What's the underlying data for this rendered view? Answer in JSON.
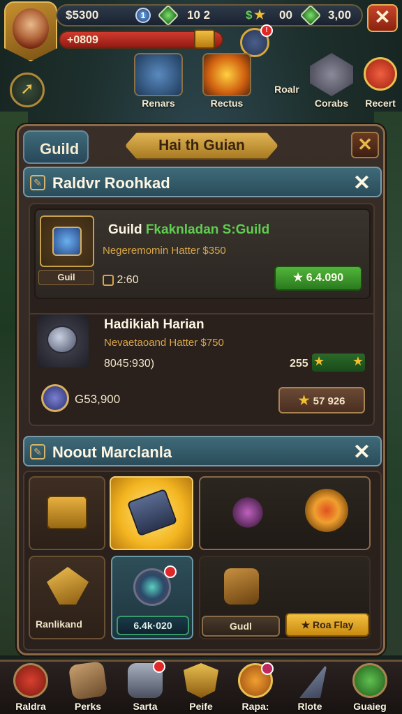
{
  "hud": {
    "gold": "$5300",
    "level_badge": "1",
    "gems": "10 2",
    "stars": "00",
    "currency": "3,00",
    "hp_value": "+0809",
    "compass_badge": "!"
  },
  "top_menu": [
    {
      "label": "Renars"
    },
    {
      "label": "Rectus"
    },
    {
      "label": "Roalr"
    },
    {
      "label": "Corabs"
    },
    {
      "label": "Recert"
    }
  ],
  "panel": {
    "tab_label": "Guild",
    "title": "Hai th Guian",
    "close_symbol": "✕"
  },
  "section1": {
    "title": "Raldvr Roohkad",
    "close_symbol": "✕",
    "offers": [
      {
        "title_prefix": "Guild ",
        "title_highlight": "Fkaknladan S:Guild",
        "subtitle": "Negeremomin Hatter $350",
        "item_label": "Guil",
        "price": "2:60",
        "button": "6.4.090"
      },
      {
        "title": "Hadikiah Harian",
        "subtitle": "Nevaetaoand Hatter $750",
        "detail": "8045:930)",
        "stars_value": "255",
        "gold_amount": "G53,900",
        "button": "57 926"
      }
    ]
  },
  "section2": {
    "title": "Noout Marclanla",
    "close_symbol": "✕",
    "cells": {
      "c1_label": "Ranlikand",
      "c2_button": "6.4k·020",
      "c3_button": "Gudl",
      "c4_button": "Roa Flay"
    }
  },
  "bottom_nav": [
    {
      "label": "Raldra"
    },
    {
      "label": "Perks"
    },
    {
      "label": "Sarta"
    },
    {
      "label": "Peife"
    },
    {
      "label": "Rapa:"
    },
    {
      "label": "Rlote"
    },
    {
      "label": "Guaieg"
    }
  ],
  "colors": {
    "accent_gold": "#e0b454",
    "buy_green": "#52b53a",
    "close_red": "#c8442a",
    "section_teal": "#3f6a78"
  }
}
